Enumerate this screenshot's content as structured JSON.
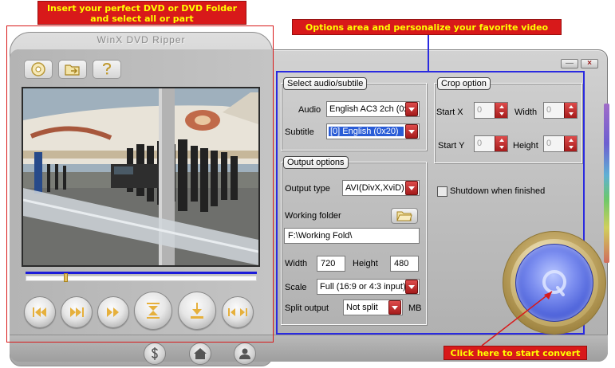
{
  "app": {
    "title": "WinX DVD Ripper",
    "window_buttons": {
      "minimize": "—",
      "close": "×"
    }
  },
  "callouts": {
    "insert_line1": "Insert your perfect DVD or DVD Folder",
    "insert_line2": "and select all or part",
    "options": "Options area and personalize your favorite video",
    "start": "Click here to start convert"
  },
  "toolbar": {
    "buttons": [
      {
        "name": "open-dvd",
        "icon": "disc-icon"
      },
      {
        "name": "open-folder",
        "icon": "folder-arrow-icon"
      },
      {
        "name": "help",
        "icon": "question-icon"
      }
    ]
  },
  "player": {
    "progress": 0.17,
    "buttons": [
      {
        "icon": "skip-back-icon"
      },
      {
        "icon": "skip-forward-icon"
      },
      {
        "icon": "fast-forward-icon"
      },
      {
        "icon": "mark-start-icon"
      },
      {
        "icon": "mark-end-icon"
      },
      {
        "icon": "rewind-to-start-icon"
      }
    ]
  },
  "bottom_nav": {
    "buttons": [
      {
        "icon": "dollar-icon"
      },
      {
        "icon": "home-icon"
      },
      {
        "icon": "person-icon"
      }
    ]
  },
  "audio_subtitle": {
    "legend": "Select audio/subtile",
    "audio_label": "Audio",
    "audio_value": "English AC3 2ch (0x",
    "subtitle_label": "Subtitle",
    "subtitle_value": "[0] English (0x20)"
  },
  "crop": {
    "legend": "Crop option",
    "start_x_label": "Start X",
    "start_x_value": "0",
    "width_label": "Width",
    "width_value": "0",
    "start_y_label": "Start Y",
    "start_y_value": "0",
    "height_label": "Height",
    "height_value": "0"
  },
  "shutdown": {
    "label": "Shutdown when finished",
    "checked": false
  },
  "output": {
    "legend": "Output options",
    "type_label": "Output type",
    "type_value": "AVI(DivX,XviD)",
    "folder_label": "Working folder",
    "folder_value": "F:\\Working Fold\\",
    "width_label": "Width",
    "width_value": "720",
    "height_label": "Height",
    "height_value": "480",
    "scale_label": "Scale",
    "scale_value": "Full (16:9 or 4:3 input)",
    "split_label": "Split output",
    "split_value": "Not split",
    "split_unit": "MB"
  },
  "colors": {
    "callout_bg": "#d8191a",
    "callout_text": "#ffff00",
    "frame_blue": "#2a2ae0",
    "combo_arrow": "#b52020",
    "convert_blue": "#5a6ce0"
  }
}
